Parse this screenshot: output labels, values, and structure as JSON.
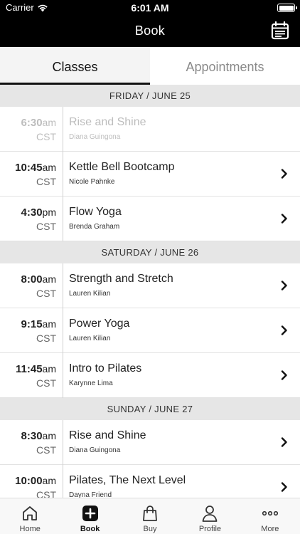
{
  "status_bar": {
    "carrier": "Carrier",
    "time": "6:01 AM"
  },
  "header": {
    "title": "Book"
  },
  "tabs": [
    {
      "label": "Classes",
      "active": true
    },
    {
      "label": "Appointments",
      "active": false
    }
  ],
  "days": [
    {
      "label": "FRIDAY / JUNE 25",
      "classes": [
        {
          "time": "6:30",
          "ampm": "am",
          "tz": "CST",
          "name": "Rise and Shine",
          "instructor": "Diana Guingona",
          "available": false
        },
        {
          "time": "10:45",
          "ampm": "am",
          "tz": "CST",
          "name": "Kettle Bell Bootcamp",
          "instructor": "Nicole Pahnke",
          "available": true
        },
        {
          "time": "4:30",
          "ampm": "pm",
          "tz": "CST",
          "name": "Flow Yoga",
          "instructor": "Brenda Graham",
          "available": true
        }
      ]
    },
    {
      "label": "SATURDAY / JUNE 26",
      "classes": [
        {
          "time": "8:00",
          "ampm": "am",
          "tz": "CST",
          "name": "Strength and Stretch",
          "instructor": "Lauren Kilian",
          "available": true
        },
        {
          "time": "9:15",
          "ampm": "am",
          "tz": "CST",
          "name": "Power Yoga",
          "instructor": "Lauren Kilian",
          "available": true
        },
        {
          "time": "11:45",
          "ampm": "am",
          "tz": "CST",
          "name": "Intro to Pilates",
          "instructor": "Karynne Lima",
          "available": true
        }
      ]
    },
    {
      "label": "SUNDAY / JUNE 27",
      "classes": [
        {
          "time": "8:30",
          "ampm": "am",
          "tz": "CST",
          "name": "Rise and Shine",
          "instructor": "Diana Guingona",
          "available": true
        },
        {
          "time": "10:00",
          "ampm": "am",
          "tz": "CST",
          "name": "Pilates, The Next Level",
          "instructor": "Dayna Friend",
          "available": true
        }
      ]
    }
  ],
  "tab_bar": [
    {
      "label": "Home",
      "icon": "home-icon",
      "active": false
    },
    {
      "label": "Book",
      "icon": "book-plus-icon",
      "active": true
    },
    {
      "label": "Buy",
      "icon": "shopping-bag-icon",
      "active": false
    },
    {
      "label": "Profile",
      "icon": "person-icon",
      "active": false
    },
    {
      "label": "More",
      "icon": "more-dots-icon",
      "active": false
    }
  ]
}
